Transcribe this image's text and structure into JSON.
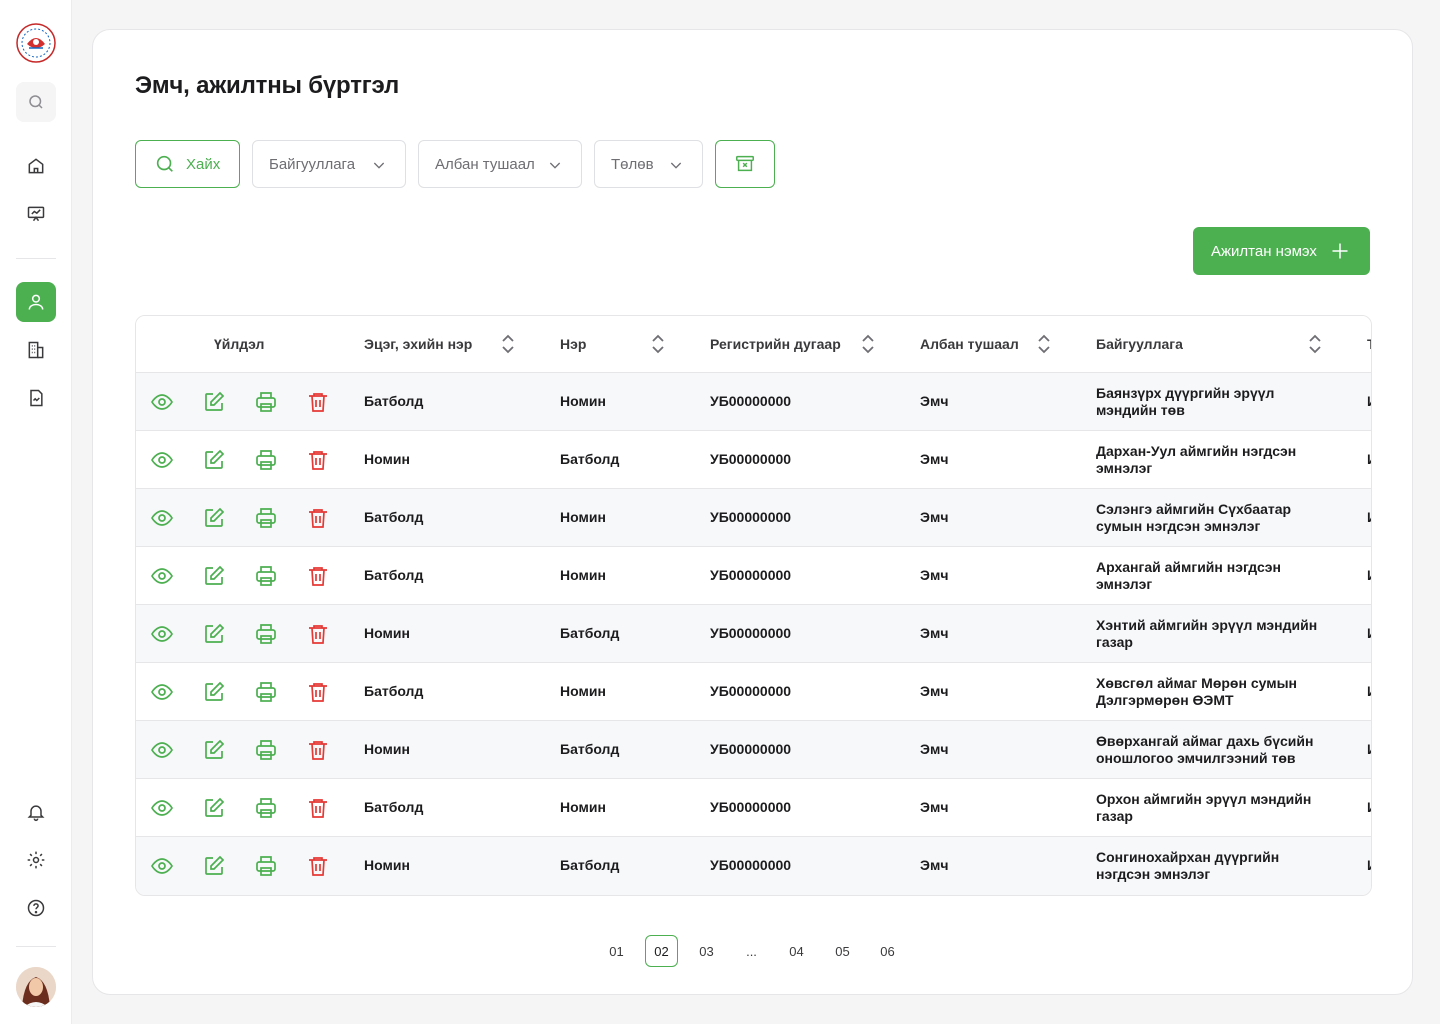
{
  "colors": {
    "accent": "#4caf50",
    "danger": "#e53935"
  },
  "page": {
    "title": "Эмч, ажилтны бүртгэл"
  },
  "filters": {
    "search_label": "Хайх",
    "organization": "Байгууллага",
    "position": "Албан тушаал",
    "status": "Төлөв"
  },
  "actions": {
    "add_employee": "Ажилтан нэмэх"
  },
  "table": {
    "headers": {
      "actions": "Үйлдэл",
      "surname": "Эцэг, эхийн нэр",
      "name": "Нэр",
      "register": "Регистрийн дугаар",
      "position": "Албан тушаал",
      "organization": "Байгууллага",
      "next": "Т"
    },
    "rows": [
      {
        "surname": "Батболд",
        "name": "Номин",
        "register": "УБ00000000",
        "position": "Эмч",
        "organization": "Баянзүрх дүүргийн эрүүл мэндийн төв",
        "next": "И"
      },
      {
        "surname": "Номин",
        "name": "Батболд",
        "register": "УБ00000000",
        "position": "Эмч",
        "organization": "Дархан-Уул аймгийн нэгдсэн эмнэлэг",
        "next": "И"
      },
      {
        "surname": "Батболд",
        "name": "Номин",
        "register": "УБ00000000",
        "position": "Эмч",
        "organization": "Сэлэнгэ аймгийн Сүхбаатар сумын нэгдсэн эмнэлэг",
        "next": "И"
      },
      {
        "surname": "Батболд",
        "name": "Номин",
        "register": "УБ00000000",
        "position": "Эмч",
        "organization": "Архангай аймгийн нэгдсэн эмнэлэг",
        "next": "И"
      },
      {
        "surname": "Номин",
        "name": "Батболд",
        "register": "УБ00000000",
        "position": "Эмч",
        "organization": "Хэнтий аймгийн эрүүл мэндийн газар",
        "next": "И"
      },
      {
        "surname": "Батболд",
        "name": "Номин",
        "register": "УБ00000000",
        "position": "Эмч",
        "organization": "Хөвсгөл аймаг Мөрөн сумын Дэлгэрмөрөн ӨЭМТ",
        "next": "И"
      },
      {
        "surname": "Номин",
        "name": "Батболд",
        "register": "УБ00000000",
        "position": "Эмч",
        "organization": "Өвөрхангай аймаг дахь бүсийн оношлогоо эмчилгээний төв",
        "next": "И"
      },
      {
        "surname": "Батболд",
        "name": "Номин",
        "register": "УБ00000000",
        "position": "Эмч",
        "organization": "Орхон аймгийн эрүүл мэндийн газар",
        "next": "И"
      },
      {
        "surname": "Номин",
        "name": "Батболд",
        "register": "УБ00000000",
        "position": "Эмч",
        "organization": "Сонгинохайрхан дүүргийн нэгдсэн эмнэлэг",
        "next": "И"
      }
    ]
  },
  "pagination": {
    "pages": [
      "01",
      "02",
      "03",
      "...",
      "04",
      "05",
      "06"
    ],
    "current": "02"
  }
}
